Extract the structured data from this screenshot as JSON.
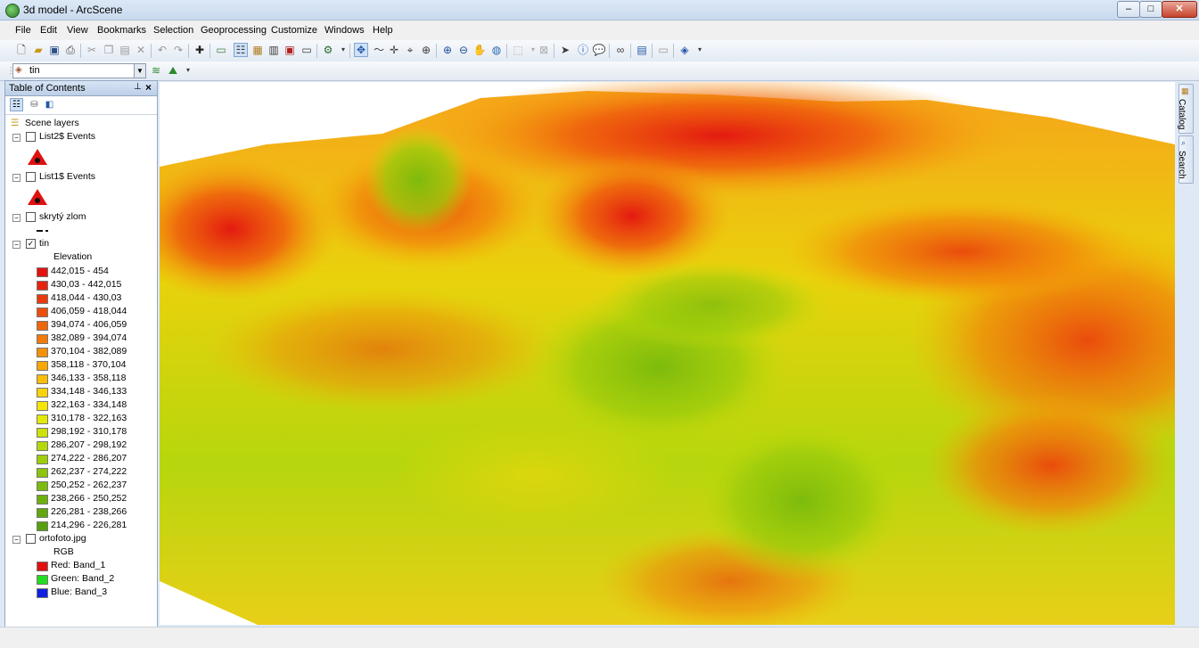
{
  "window": {
    "title": "3d model - ArcScene",
    "min": "–",
    "max": "□",
    "close": "✕"
  },
  "menu": [
    "File",
    "Edit",
    "View",
    "Bookmarks",
    "Selection",
    "Geoprocessing",
    "Customize",
    "Windows",
    "Help"
  ],
  "layer_combo": {
    "value": "tin"
  },
  "toc": {
    "title": "Table of Contents",
    "root": "Scene layers",
    "layers": [
      {
        "name": "List2$ Events",
        "checked": false
      },
      {
        "name": "List1$ Events",
        "checked": false
      },
      {
        "name": "skrytý zlom",
        "checked": false
      },
      {
        "name": "tin",
        "checked": true
      },
      {
        "name": "ortofoto.jpg",
        "checked": false
      }
    ],
    "elevation_heading": "Elevation",
    "elevation_classes": [
      {
        "label": "442,015 - 454",
        "color": "#e3120f"
      },
      {
        "label": "430,03 - 442,015",
        "color": "#e6240e"
      },
      {
        "label": "418,044 - 430,03",
        "color": "#e9390d"
      },
      {
        "label": "406,059 - 418,044",
        "color": "#ec4f0c"
      },
      {
        "label": "394,074 - 406,059",
        "color": "#ef650b"
      },
      {
        "label": "382,089 - 394,074",
        "color": "#f27b0a"
      },
      {
        "label": "370,104 - 382,089",
        "color": "#f59109"
      },
      {
        "label": "358,118 - 370,104",
        "color": "#f7a708"
      },
      {
        "label": "346,133 - 358,118",
        "color": "#f9bd08"
      },
      {
        "label": "334,148 - 346,133",
        "color": "#fad307"
      },
      {
        "label": "322,163 - 334,148",
        "color": "#f6e407"
      },
      {
        "label": "310,178 - 322,163",
        "color": "#e4ea07"
      },
      {
        "label": "298,192 - 310,178",
        "color": "#cce208"
      },
      {
        "label": "286,207 - 298,192",
        "color": "#b4d909"
      },
      {
        "label": "274,222 - 286,207",
        "color": "#9fcf0a"
      },
      {
        "label": "262,237 - 274,222",
        "color": "#8cc50b"
      },
      {
        "label": "250,252 - 262,237",
        "color": "#7cbb0c"
      },
      {
        "label": "238,266 - 250,252",
        "color": "#6db10d"
      },
      {
        "label": "226,281 - 238,266",
        "color": "#60a80e"
      },
      {
        "label": "214,296 - 226,281",
        "color": "#56a00f"
      }
    ],
    "rgb_heading": "RGB",
    "rgb_bands": [
      {
        "label": "Red:   Band_1",
        "color": "#e01010"
      },
      {
        "label": "Green: Band_2",
        "color": "#22dd22"
      },
      {
        "label": "Blue:  Band_3",
        "color": "#1020e0"
      }
    ]
  },
  "side_tabs": [
    "Catalog",
    "Search"
  ]
}
